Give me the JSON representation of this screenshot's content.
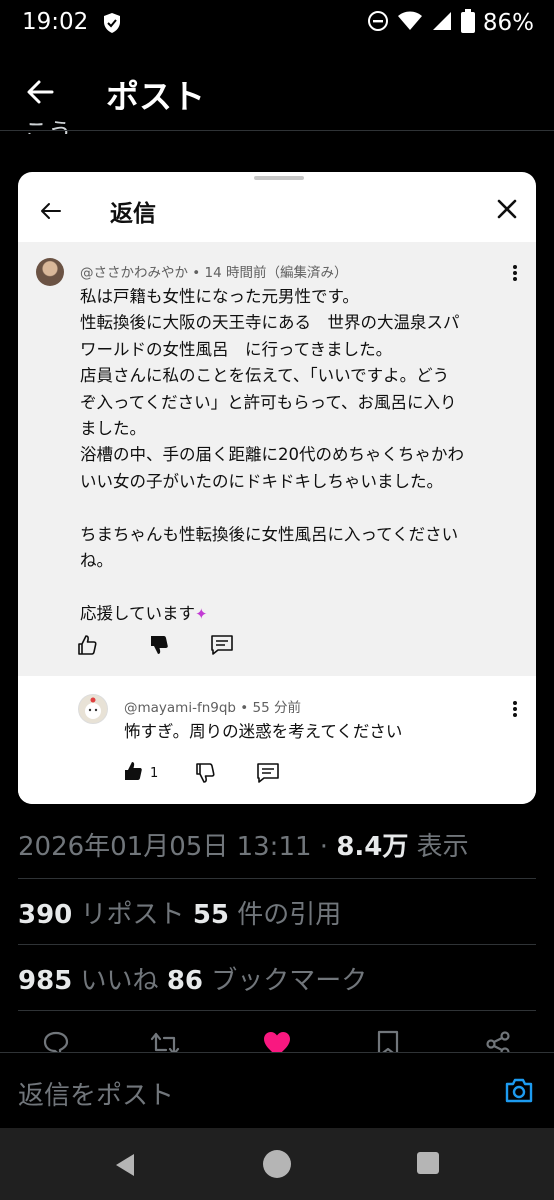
{
  "status_bar": {
    "time": "19:02",
    "battery_pct": "86%"
  },
  "header": {
    "title": "ポスト"
  },
  "peek_text": "こう",
  "card": {
    "title": "返信",
    "comment": {
      "meta": "@ささかわみやか • 14 時間前（編集済み）",
      "lines": [
        "私は戸籍も女性になった元男性です。",
        "性転換後に大阪の天王寺にある　世界の大温泉スパ",
        "ワールドの女性風呂　に行ってきました。",
        "店員さんに私のことを伝えて、「いいですよ。どう",
        "ぞ入ってください」と許可もらって、お風呂に入り",
        "ました。",
        "浴槽の中、手の届く距離に20代のめちゃくちゃかわ",
        "いい女の子がいたのにドキドキしちゃいました。",
        "",
        "ちまちゃんも性転換後に女性風呂に入ってください",
        "ね。",
        "",
        "応援しています"
      ]
    },
    "reply": {
      "meta": "@mayami-fn9qb • 55 分前",
      "text": "怖すぎ。周りの迷惑を考えてください",
      "like_count": "1"
    }
  },
  "post": {
    "timestamp": "2026年01月05日 13:11 · ",
    "views_number": "8.4万",
    "views_label": " 表示",
    "reposts_number": "390",
    "reposts_label": " リポスト ",
    "quotes_number": "55",
    "quotes_label": " 件の引用",
    "likes_number": "985",
    "likes_label": " いいね ",
    "bookmarks_number": "86",
    "bookmarks_label": " ブックマーク"
  },
  "reply_bar": {
    "placeholder": "返信をポスト"
  },
  "colors": {
    "accent": "#1d9bf0",
    "like": "#f91880",
    "background": "#000000"
  }
}
